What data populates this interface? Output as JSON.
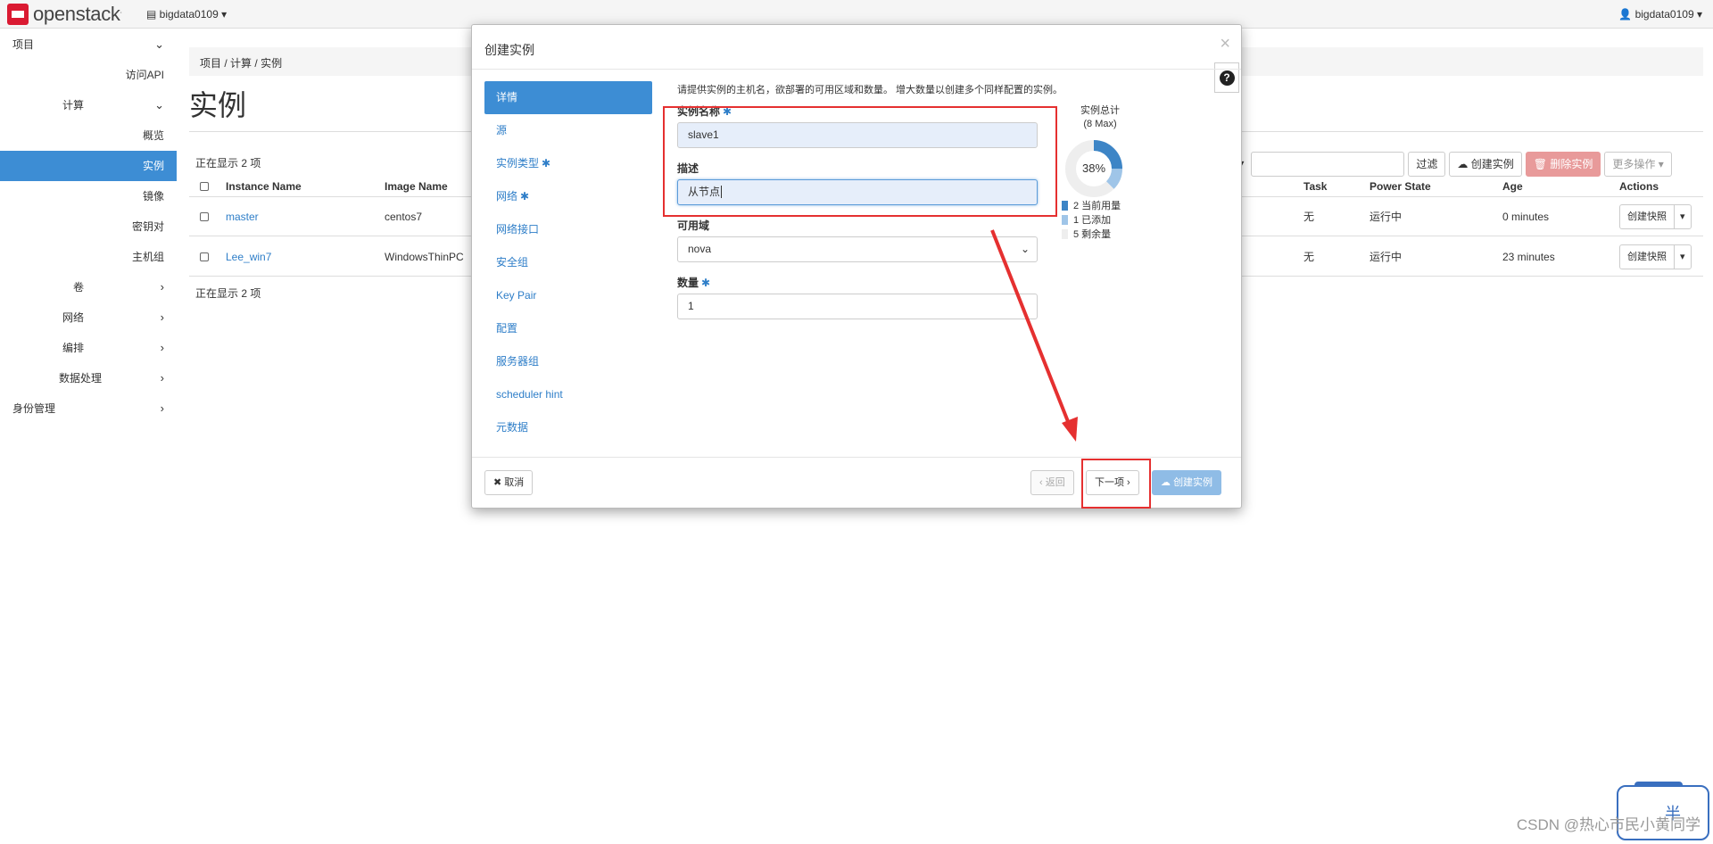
{
  "topbar": {
    "logo_text": "openstack",
    "logo_mark": ".",
    "project_selector": "bigdata0109",
    "user_menu": "bigdata0109"
  },
  "sidebar": {
    "items": [
      {
        "label": "项目",
        "level": 0,
        "chevron": "down"
      },
      {
        "label": "访问API",
        "level": 2
      },
      {
        "label": "计算",
        "level": 1,
        "chevron": "down"
      },
      {
        "label": "概览",
        "level": 2
      },
      {
        "label": "实例",
        "level": 2,
        "active": true
      },
      {
        "label": "镜像",
        "level": 2
      },
      {
        "label": "密钥对",
        "level": 2
      },
      {
        "label": "主机组",
        "level": 2
      },
      {
        "label": "卷",
        "level": 1,
        "chevron": "right"
      },
      {
        "label": "网络",
        "level": 1,
        "chevron": "right"
      },
      {
        "label": "编排",
        "level": 1,
        "chevron": "right"
      },
      {
        "label": "数据处理",
        "level": 1,
        "chevron": "right"
      },
      {
        "label": "身份管理",
        "level": 0,
        "chevron": "right"
      }
    ]
  },
  "main": {
    "breadcrumb": [
      "项目",
      "计算",
      "实例"
    ],
    "title": "实例",
    "toolbar": {
      "filter_label": "过滤",
      "create_label": "创建实例",
      "delete_label": "删除实例",
      "more_label": "更多操作"
    },
    "showing_top": "正在显示 2 项",
    "showing_bottom": "正在显示 2 项",
    "columns": [
      "Instance Name",
      "Image Name",
      "Task",
      "Power State",
      "Age",
      "Actions"
    ],
    "rows": [
      {
        "name": "master",
        "image": "centos7",
        "task": "无",
        "power": "运行中",
        "age": "0 minutes",
        "action": "创建快照"
      },
      {
        "name": "Lee_win7",
        "image": "WindowsThinPC",
        "task": "无",
        "power": "运行中",
        "age": "23 minutes",
        "action": "创建快照"
      }
    ]
  },
  "modal": {
    "title": "创建实例",
    "nav": [
      {
        "label": "详情",
        "active": true
      },
      {
        "label": "源"
      },
      {
        "label": "实例类型",
        "required": true
      },
      {
        "label": "网络",
        "required": true
      },
      {
        "label": "网络接口"
      },
      {
        "label": "安全组"
      },
      {
        "label": "Key Pair"
      },
      {
        "label": "配置"
      },
      {
        "label": "服务器组"
      },
      {
        "label": "scheduler hint"
      },
      {
        "label": "元数据"
      }
    ],
    "intro": "请提供实例的主机名，欲部署的可用区域和数量。 增大数量以创建多个同样配置的实例。",
    "fields": {
      "name_label": "实例名称",
      "name_value": "slave1",
      "desc_label": "描述",
      "desc_value": "从节点",
      "az_label": "可用域",
      "az_value": "nova",
      "count_label": "数量",
      "count_value": "1"
    },
    "quota": {
      "title": "实例总计",
      "max": "(8 Max)",
      "percent_label": "38%",
      "used": 2,
      "added": 1,
      "remaining": 5,
      "legend": [
        "2 当前用量",
        "1 已添加",
        "5 剩余量"
      ],
      "colors": {
        "used": "#3d85c6",
        "added": "#9fc5e8",
        "remaining": "#eeeeee"
      }
    },
    "buttons": {
      "cancel": "取消",
      "back": "返回",
      "next": "下一项",
      "create": "创建实例"
    }
  },
  "watermark": {
    "text": "CSDN @热心市民小黄同学",
    "mascot_text": "半"
  }
}
